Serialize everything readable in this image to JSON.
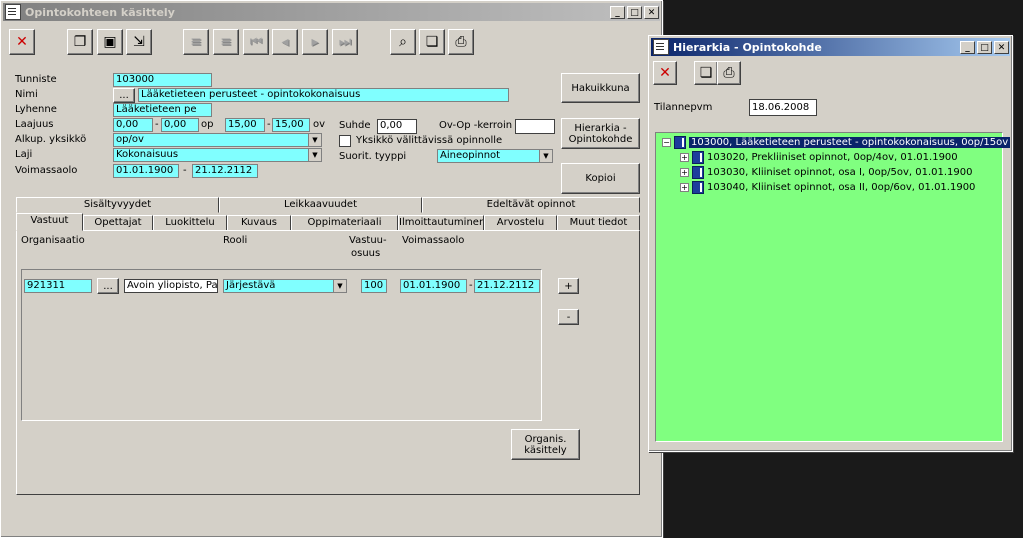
{
  "main_window": {
    "title": "Opintokohteen käsittely",
    "form": {
      "tunniste_label": "Tunniste",
      "tunniste_value": "103000",
      "nimi_label": "Nimi",
      "nimi_button": "...",
      "nimi_value": "Lääketieteen perusteet - opintokokonaisuus",
      "lyhenne_label": "Lyhenne",
      "lyhenne_value": "Lääketieteen pe",
      "laajuus_label": "Laajuus",
      "laajuus_min_op": "0,00",
      "laajuus_max_op": "0,00",
      "op_label": "op",
      "laajuus_min_ov": "15,00",
      "laajuus_max_ov": "15,00",
      "ov_label": "ov",
      "dash": "-",
      "alkup_label": "Alkup. yksikkö",
      "alkup_value": "op/ov",
      "laji_label": "Laji",
      "laji_value": "Kokonaisuus",
      "voimassaolo_label": "Voimassaolo",
      "voimassa_from": "01.01.1900",
      "voimassa_to": "21.12.2112",
      "suhde_label": "Suhde",
      "suhde_value": "0,00",
      "ovop_label": "Ov-Op -kerroin",
      "ovop_value": "",
      "yksikko_check_label": "Yksikkö välittävissä opinnolle",
      "suorit_label": "Suorit. tyyppi",
      "suorit_value": "Aineopinnot"
    },
    "buttons": {
      "hakuikkuna": "Hakuikkuna",
      "hierarkia_1": "Hierarkia -",
      "hierarkia_2": "Opintokohde",
      "kopioi": "Kopioi",
      "organis_1": "Organis.",
      "organis_2": "käsittely"
    },
    "tabs_row1": [
      "Sisältyvyydet",
      "Leikkaavuudet",
      "Edeltävät opinnot"
    ],
    "tabs_row2": [
      "Vastuut",
      "Opettajat",
      "Luokittelu",
      "Kuvaus",
      "Oppimateriaali",
      "Ilmoittautuminen",
      "Arvostelu",
      "Muut tiedot"
    ],
    "vastuut": {
      "col_org": "Organisaatio",
      "col_rooli": "Rooli",
      "col_vastuu_1": "Vastuu-",
      "col_vastuu_2": "osuus",
      "col_voimassa": "Voimassaolo",
      "row": {
        "org_id": "921311",
        "org_button": "...",
        "org_name": "Avoin yliopisto, Palm",
        "rooli": "Järjestävä",
        "osuus": "100",
        "from": "01.01.1900",
        "to": "21.12.2112"
      },
      "add_label": "+",
      "remove_label": "-"
    }
  },
  "hier_window": {
    "title": "Hierarkia - Opintokohde",
    "tilannepvm_label": "Tilannepvm",
    "tilannepvm_value": "18.06.2008",
    "tree": [
      {
        "label": "103000, Lääketieteen perusteet - opintokokonaisuus, 0op/15ov",
        "expander": "−"
      },
      {
        "label": "103020, Prekliiniset opinnot, 0op/4ov, 01.01.1900",
        "expander": "+"
      },
      {
        "label": "103030, Kliiniset opinnot, osa I, 0op/5ov, 01.01.1900",
        "expander": "+"
      },
      {
        "label": "103040, Kliiniset opinnot, osa II, 0op/6ov, 01.01.1900",
        "expander": "+"
      }
    ]
  },
  "colors": {
    "field_cyan": "#80ffff",
    "tree_green": "#80ff80",
    "face": "#d4d0c8",
    "active_title": "#0a246a"
  }
}
